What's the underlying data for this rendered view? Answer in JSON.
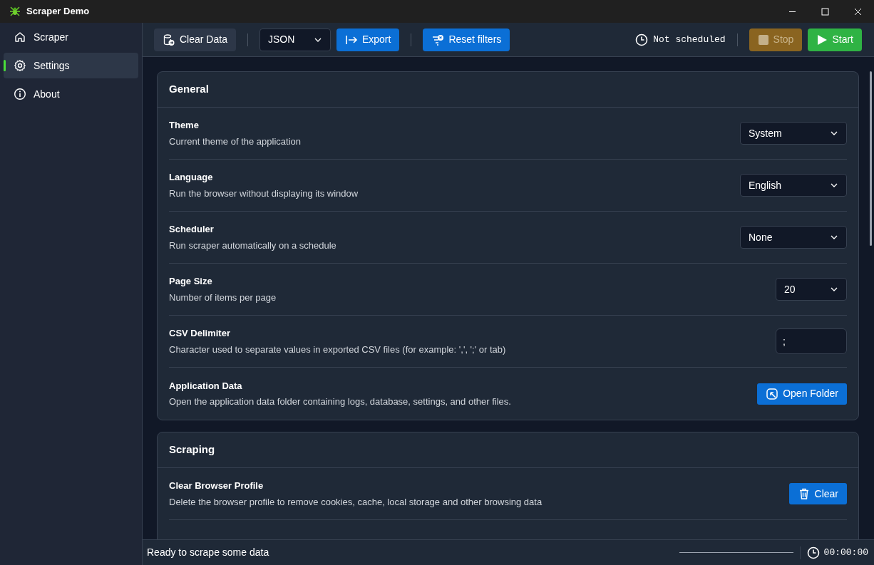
{
  "window": {
    "title": "Scraper Demo"
  },
  "sidebar": {
    "items": [
      {
        "label": "Scraper",
        "selected": false
      },
      {
        "label": "Settings",
        "selected": true
      },
      {
        "label": "About",
        "selected": false
      }
    ]
  },
  "toolbar": {
    "items": [
      {
        "kind": "ghost",
        "label": "Clear Data"
      },
      {
        "kind": "divider"
      },
      {
        "kind": "select",
        "value": "JSON"
      },
      {
        "kind": "primary",
        "label": "Export"
      },
      {
        "kind": "divider"
      },
      {
        "kind": "primary",
        "label": "Reset filters"
      }
    ],
    "schedule": "Not scheduled",
    "run_buttons": [
      {
        "kind": "stop",
        "label": "Stop",
        "disabled": true
      },
      {
        "kind": "start",
        "label": "Start",
        "disabled": false
      }
    ]
  },
  "sections": [
    {
      "title": "General",
      "rows": [
        {
          "title": "Theme",
          "description": "Current theme of the application",
          "kind": "select",
          "value": "System"
        },
        {
          "title": "Language",
          "description": "Run the browser without displaying its window",
          "kind": "select",
          "value": "English"
        },
        {
          "title": "Scheduler",
          "description": "Run scraper automatically on a schedule",
          "kind": "select",
          "value": "None"
        },
        {
          "title": "Page Size",
          "description": "Number of items per page",
          "kind": "small-select",
          "value": "20"
        },
        {
          "title": "CSV Delimiter",
          "description": "Character used to separate values in exported CSV files (for example: ',', ';' or tab)",
          "kind": "input",
          "value": ";"
        },
        {
          "title": "Application Data",
          "description": "Open the application data folder containing logs, database, settings, and other files.",
          "kind": "button",
          "label": "Open Folder"
        }
      ]
    },
    {
      "title": "Scraping",
      "rows": [
        {
          "title": "Clear Browser Profile",
          "description": "Delete the browser profile to remove cookies, cache, local storage and other browsing data",
          "kind": "button",
          "label": "Clear"
        }
      ]
    }
  ],
  "status_bar": {
    "message": "Ready to scrape some data",
    "elapsed": "00:00:00"
  }
}
